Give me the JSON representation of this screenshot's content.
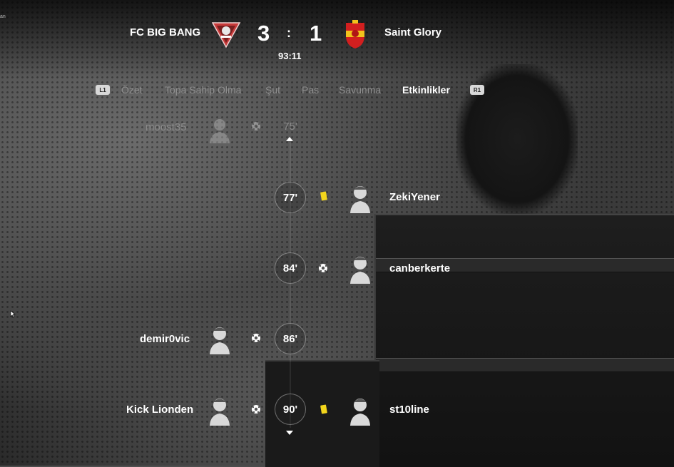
{
  "corner_label": "an",
  "scoreboard": {
    "home_team": "FC BIG BANG",
    "away_team": "Saint Glory",
    "home_score": "3",
    "separator": ":",
    "away_score": "1",
    "clock": "93:11"
  },
  "tabs": {
    "left_hint": "L1",
    "right_hint": "R1",
    "items": [
      "Özet",
      "Topa Sahip Olma",
      "Şut",
      "Pas",
      "Savunma",
      "Etkinlikler"
    ],
    "active": "Etkinlikler"
  },
  "events": [
    {
      "minute": "75'",
      "player": "moost35",
      "side": "home",
      "type": "goal",
      "faded": true
    },
    {
      "minute": "77'",
      "player": "ZekiYener",
      "side": "away",
      "type": "yellow-card"
    },
    {
      "minute": "84'",
      "player": "canberkerte",
      "side": "away",
      "type": "goal"
    },
    {
      "minute": "86'",
      "player": "demir0vic",
      "side": "home",
      "type": "goal"
    },
    {
      "minute": "90'",
      "home_player": "Kick Lionden",
      "home_type": "goal",
      "away_player": "st10line",
      "away_type": "yellow-card"
    }
  ],
  "colors": {
    "yellow_card": "#f2d51c",
    "inactive_tab": "#8f8f8f",
    "home_badge": "#d94a4a",
    "away_badge": "#d21f1f"
  }
}
